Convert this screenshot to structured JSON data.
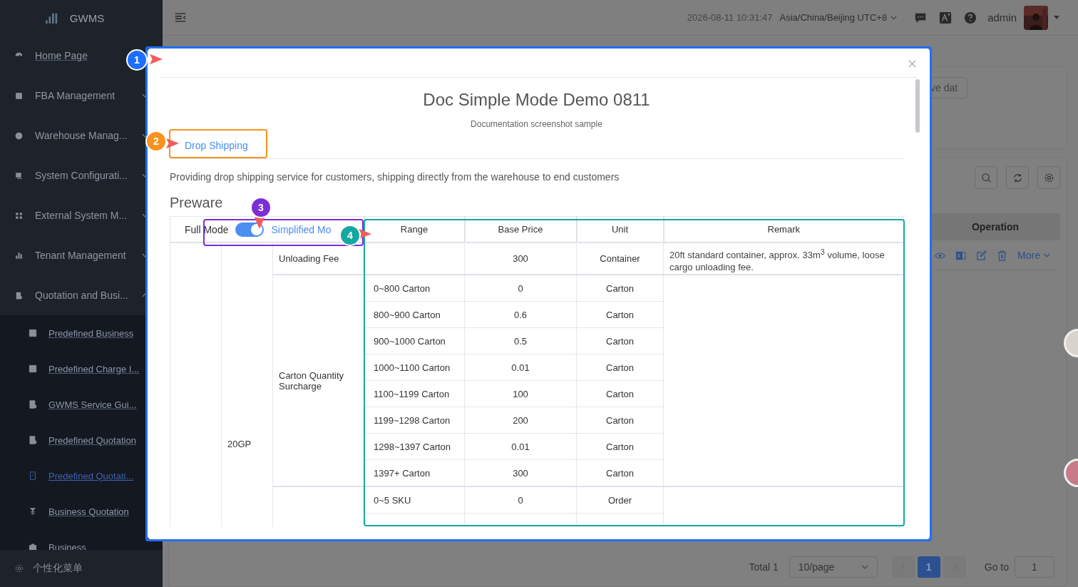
{
  "sidebar": {
    "logo": "GWMS",
    "items": [
      {
        "label": "Home Page",
        "kind": "link"
      },
      {
        "label": "FBA Management",
        "kind": "group",
        "expanded": false
      },
      {
        "label": "Warehouse Manag...",
        "kind": "group",
        "expanded": false
      },
      {
        "label": "System Configurati...",
        "kind": "group",
        "expanded": false
      },
      {
        "label": "External System M...",
        "kind": "group",
        "expanded": false
      },
      {
        "label": "Tenant Management",
        "kind": "group",
        "expanded": false
      },
      {
        "label": "Quotation and Busi...",
        "kind": "group",
        "expanded": true,
        "children": [
          {
            "label": "Predefined Business",
            "selected": false
          },
          {
            "label": "Predefined Charge I...",
            "selected": false
          },
          {
            "label": "GWMS Service Gui...",
            "selected": false
          },
          {
            "label": "Predefined Quotation",
            "selected": false
          },
          {
            "label": "Predefined Quotati...",
            "selected": true
          },
          {
            "label": "Business Quotation",
            "selected": false
          },
          {
            "label": "Business",
            "selected": false
          }
        ]
      }
    ],
    "footer": "个性化菜单"
  },
  "topbar": {
    "datetime": "2026-08-11 10:31:47",
    "timezone": "Asia/China/Beijing UTC+8",
    "user": "admin"
  },
  "background": {
    "filter_button": "ve dat",
    "table_header": "Operation",
    "row_action": "More",
    "pagination": {
      "total": "Total 1",
      "page_size": "10/page",
      "current": "1",
      "goto_label": "Go to",
      "goto_value": "1"
    }
  },
  "modal": {
    "title": "Doc Simple Mode Demo 0811",
    "subtitle": "Documentation screenshot sample",
    "tabs": [
      {
        "label": "Drop Shipping",
        "selected": true
      }
    ],
    "description": "Providing drop shipping service for customers, shipping directly from the warehouse to end customers",
    "section": "Preware",
    "mode": {
      "left": "Full Mode",
      "right": "Simplified Mo",
      "on": true
    },
    "table": {
      "columns": [
        "Range",
        "Base Price",
        "Unit",
        "Remark"
      ],
      "container": "20GP",
      "groups": [
        {
          "name": "Unloading Fee",
          "remark": "20ft standard container, approx. 33m$^{3}$ volume, loose cargo unloading fee.",
          "rows": [
            {
              "price": "300",
              "unit": "Container"
            }
          ]
        },
        {
          "name": "Carton Quantity Surcharge",
          "rows": [
            {
              "range": "0~800 Carton",
              "price": "0",
              "unit": "Carton"
            },
            {
              "range": "800~900 Carton",
              "price": "0.6",
              "unit": "Carton"
            },
            {
              "range": "900~1000 Carton",
              "price": "0.5",
              "unit": "Carton"
            },
            {
              "range": "1000~1100 Carton",
              "price": "0.01",
              "unit": "Carton"
            },
            {
              "range": "1100~1199 Carton",
              "price": "100",
              "unit": "Carton"
            },
            {
              "range": "1199~1298 Carton",
              "price": "200",
              "unit": "Carton"
            },
            {
              "range": "1298~1397 Carton",
              "price": "0.01",
              "unit": "Carton"
            },
            {
              "range": "1397+ Carton",
              "price": "300",
              "unit": "Carton"
            }
          ]
        },
        {
          "rows": [
            {
              "range": "0~5 SKU",
              "price": "0",
              "unit": "Order"
            }
          ]
        }
      ]
    }
  },
  "annotations": [
    {
      "number": "1",
      "color": "#1f6fff",
      "framed": true
    },
    {
      "number": "2",
      "color": "#f7931e",
      "framed": true
    },
    {
      "number": "3",
      "color": "#7b2fd6",
      "framed": true
    },
    {
      "number": "4",
      "color": "#14a8a0",
      "framed": true
    }
  ]
}
